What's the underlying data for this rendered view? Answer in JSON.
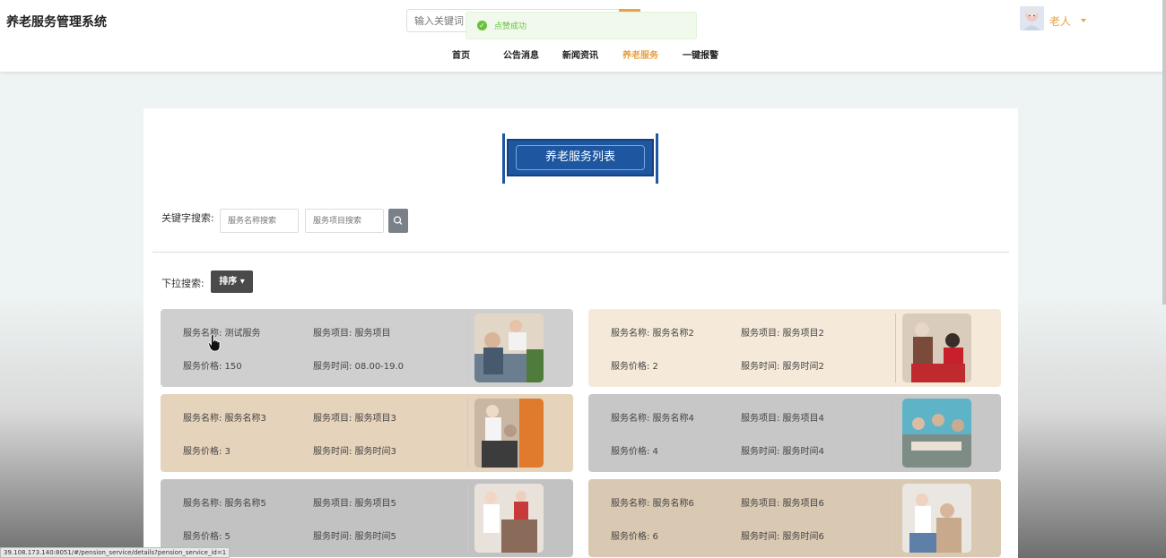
{
  "header": {
    "site_title": "养老服务管理系统",
    "search_placeholder": "输入关键词",
    "toast": "点赞成功",
    "user_name": "老人",
    "nav": [
      "首页",
      "公告消息",
      "新闻资讯",
      "养老服务",
      "一键报警"
    ],
    "active_nav": "养老服务"
  },
  "main": {
    "banner_title": "养老服务列表",
    "keyword_label": "关键字搜索:",
    "name_search_placeholder": "服务名称搜索",
    "item_search_placeholder": "服务项目搜索",
    "dropdown_label": "下拉搜索:",
    "sort_label": "排序"
  },
  "cards": [
    {
      "name": "服务名称: 测试服务",
      "item": "服务项目: 服务项目",
      "price": "服务价格: 150",
      "time": "服务时间: 08.00-19.0"
    },
    {
      "name": "服务名称: 服务名称2",
      "item": "服务项目: 服务项目2",
      "price": "服务价格: 2",
      "time": "服务时间: 服务时间2"
    },
    {
      "name": "服务名称: 服务名称3",
      "item": "服务项目: 服务项目3",
      "price": "服务价格: 3",
      "time": "服务时间: 服务时间3"
    },
    {
      "name": "服务名称: 服务名称4",
      "item": "服务项目: 服务项目4",
      "price": "服务价格: 4",
      "time": "服务时间: 服务时间4"
    },
    {
      "name": "服务名称: 服务名称5",
      "item": "服务项目: 服务项目5",
      "price": "服务价格: 5",
      "time": "服务时间: 服务时间5"
    },
    {
      "name": "服务名称: 服务名称6",
      "item": "服务项目: 服务项目6",
      "price": "服务价格: 6",
      "time": "服务时间: 服务时间6"
    }
  ],
  "status_url": "39.108.173.140:8051/#/pension_service/details?pension_service_id=1",
  "colors": {
    "accent": "#e8a248",
    "banner": "#1e56a0",
    "success": "#67c23a"
  }
}
